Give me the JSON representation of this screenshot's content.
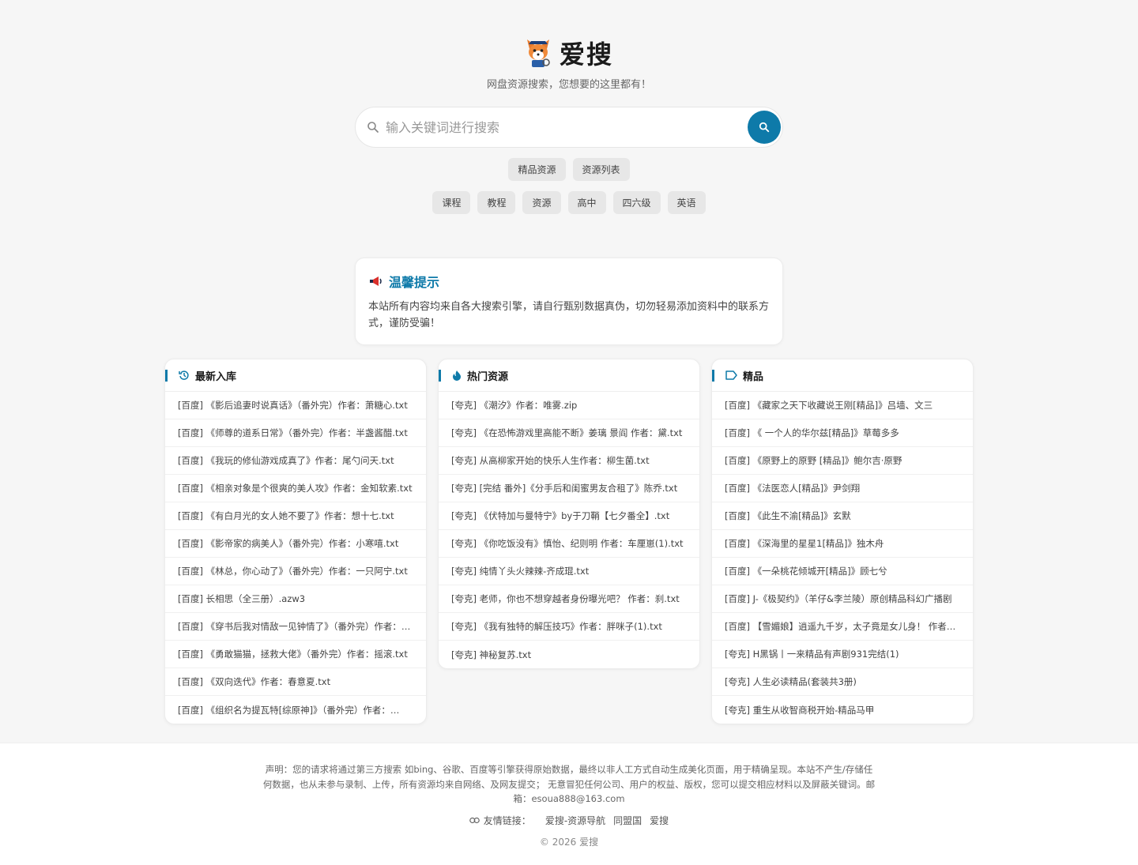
{
  "site": {
    "title": "爱搜",
    "subtitle": "网盘资源搜索，您想要的这里都有！"
  },
  "search": {
    "placeholder": "输入关键词进行搜索",
    "value": ""
  },
  "quick_links": [
    "精品资源",
    "资源列表"
  ],
  "hot_tags": [
    "课程",
    "教程",
    "资源",
    "高中",
    "四六级",
    "英语"
  ],
  "notice": {
    "title": "温馨提示",
    "body": "本站所有内容均来自各大搜索引擎，请自行甄别数据真伪，切勿轻易添加资料中的联系方式，谨防受骗！"
  },
  "columns": [
    {
      "title": "最新入库",
      "icon": "history-icon",
      "items": [
        "[百度] 《影后追妻时说真话》（番外完）作者：萧糖心.txt",
        "[百度] 《师尊的道系日常》（番外完）作者：半盏酱醋.txt",
        "[百度] 《我玩的修仙游戏成真了》作者：尾勺问天.txt",
        "[百度] 《相亲对象是个很爽的美人攻》作者：金知软素.txt",
        "[百度] 《有白月光的女人她不要了》作者：想十七.txt",
        "[百度] 《影帝家的病美人》（番外完）作者：小寒嘻.txt",
        "[百度] 《林总，你心动了》（番外完）作者：一只阿宁.txt",
        "[百度] 长相思（全三册）.azw3",
        "[百度] 《穿书后我对情敌一见钟情了》（番外完）作者：…",
        "[百度] 《勇敢猫猫，拯救大佬》（番外完）作者：摇滚.txt",
        "[百度] 《双向迭代》作者：春意夏.txt",
        "[百度] 《组织名为提瓦特[综原神]》（番外完）作者：…"
      ]
    },
    {
      "title": "热门资源",
      "icon": "fire-icon",
      "items": [
        "[夸克] 《潮汐》作者：唯雾.zip",
        "[夸克] 《在恐怖游戏里高能不断》姜璃 景阎 作者：黛.txt",
        "[夸克] 从高柳家开始的快乐人生作者：柳生菌.txt",
        "[夸克] [完结 番外]《分手后和闺蜜男友合租了》陈乔.txt",
        "[夸克] 《伏特加与曼特宁》by于刀鞘【七夕番全】.txt",
        "[夸克] 《你吃饭没有》慎怡、纪则明 作者：车厘崽(1).txt",
        "[夸克] 纯情丫头火辣辣-齐成琨.txt",
        "[夸克] 老师，你也不想穿越者身份曝光吧？ 作者：刹.txt",
        "[夸克] 《我有独特的解压技巧》作者：胖咪子(1).txt",
        "[夸克] 神秘复苏.txt"
      ]
    },
    {
      "title": "精品",
      "icon": "tag-icon",
      "items": [
        "[百度] 《藏家之天下收藏说王刚[精品]》吕墙、文三",
        "[百度] 《 一个人的华尔兹[精品]》草莓多多",
        "[百度] 《原野上的原野 [精品]》鲍尔吉·原野",
        "[百度] 《法医恋人[精品]》尹剑翔",
        "[百度] 《此生不渝[精品]》玄默",
        "[百度] 《深海里的星星1[精品]》独木舟",
        "[百度] 《一朵桃花倾城开[精品]》顾七兮",
        "[百度] J-《极契约》（羊仔&李兰陵）原创精品科幻广播剧",
        "[百度] 【雪媚娘】逍遥九千岁，太子竟是女儿身！ 作者：…",
        "[夸克] H黑锅丨一来精品有声剧931完结(1)",
        "[夸克] 人生必读精品(套装共3册)",
        "[夸克] 重生从收智商税开始-精品马甲"
      ]
    }
  ],
  "footer": {
    "disclaimer": "声明：您的请求将通过第三方搜索 如bing、谷歌、百度等引擎获得原始数据，最终以非人工方式自动生成美化页面，用于精确呈现。本站不产生/存储任何数据，也从未参与录制、上传，所有资源均来自网络、及网友提交； 无意冒犯任何公司、用户的权益、版权，您可以提交相应材料以及屏蔽关键词。邮箱：esoua888@163.com",
    "links_label": "友情链接：",
    "links": [
      "爱搜-资源导航",
      "同盟国",
      "爱搜"
    ],
    "copyright": "© 2026 爱搜"
  },
  "colors": {
    "accent": "#0e7aa9",
    "background": "#f6f6f6",
    "chip": "#e7e7e7"
  }
}
